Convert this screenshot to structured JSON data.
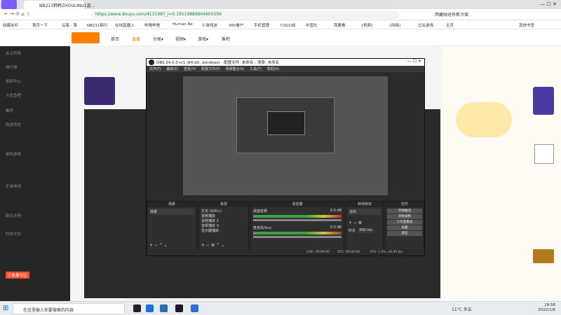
{
  "browser": {
    "tabs": [
      {
        "label": "NB211韩韩ZHOULINU1直…",
        "active": true
      }
    ],
    "url": "https://www.douyu.com/4131997_i=0.19519889904605556",
    "search_hint": "西藏财经有新冷增",
    "bookmarks": [
      "收藏夹栏",
      "首页一下",
      "云笔 - 我",
      "NB211韩行",
      "在线直播入",
      "哔哩哔哩",
      "Human Be",
      "小游戏迷",
      "360看户",
      "手机管理",
      "CSGO战",
      "中国头",
      "我要看",
      "[视频]",
      "[网络]",
      "过关游戏",
      "主页",
      "其他书签"
    ]
  },
  "site": {
    "nav": [
      "首页",
      "直播",
      "分类▾",
      "视频▾",
      "游戏▾",
      "鱼吧"
    ],
    "sidebar": [
      "关注列表",
      "排行榜",
      "视频中心",
      "斗鱼鱼吧",
      "推荐",
      "网游竞技",
      "单机游戏",
      "手游休闲",
      "娱乐天地",
      "科技文化",
      "正能量专区"
    ]
  },
  "obs": {
    "title": "OBS 24.0.0-rc1 (64-bit, windows) - 配置文件: 未命名 - 场景: 未命名",
    "menu": [
      "文件(F)",
      "编辑(E)",
      "查看(V)",
      "配置文件(P)",
      "场景集合(S)",
      "工具(T)",
      "帮助(H)"
    ],
    "docks": {
      "scenes": {
        "header": "场景",
        "items": [
          "场景"
        ]
      },
      "sources": {
        "header": "来源",
        "items": [
          "文本 (GDI+)",
          "音频捕获",
          "音频捕获 2",
          "音频捕获 3",
          "显示器捕获"
        ]
      },
      "mixer": {
        "header": "混音器",
        "tracks": [
          {
            "name": "桌面音频",
            "db": "0.0 dB"
          },
          {
            "name": "麦克风/Aux",
            "db": "0.0 dB"
          }
        ]
      },
      "transitions": {
        "header": "转场特效",
        "type": "淡出",
        "duration_label": "时长",
        "duration": "300 ms"
      },
      "controls": {
        "header": "控件",
        "buttons": [
          "开始推流",
          "开始录制",
          "工作室模式",
          "设置",
          "退出"
        ]
      }
    },
    "status": {
      "live": "LIVE: 00:00:00",
      "rec": "REC: 00:00:00",
      "cpu": "CPU: 1.0%, 40.00 fps"
    }
  },
  "taskbar": {
    "search_placeholder": "在这里输入你要搜索的内容",
    "weather": "11°C 多云",
    "time": "19:56",
    "date": "2022/1/6"
  },
  "colors": {
    "douyu_orange": "#ff7e00",
    "obs_bg": "#2b2b2b",
    "taskbar_bg": "#e9ecef"
  }
}
